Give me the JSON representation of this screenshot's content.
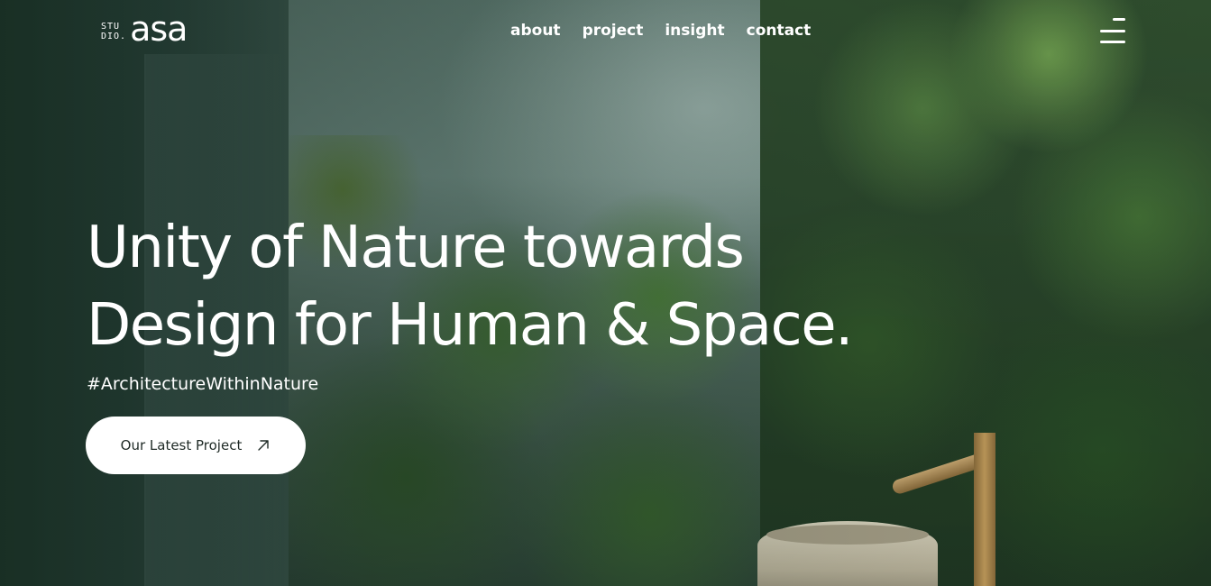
{
  "logo": {
    "small_top": "STU",
    "small_bottom": "DIO.",
    "wordmark": "asa"
  },
  "nav": {
    "items": [
      {
        "label": "about"
      },
      {
        "label": "project"
      },
      {
        "label": "insight"
      },
      {
        "label": "contact"
      }
    ]
  },
  "menu": {
    "icon": "menu-icon"
  },
  "hero": {
    "headline_line1": "Unity of Nature towards",
    "headline_line2": "Design for Human & Space.",
    "hashtag": "#ArchitectureWithinNature",
    "cta_label": "Our Latest Project",
    "cta_icon": "arrow-up-right-icon"
  },
  "colors": {
    "text": "#ffffff",
    "button_bg": "#ffffff",
    "button_text": "#1f2a26"
  }
}
